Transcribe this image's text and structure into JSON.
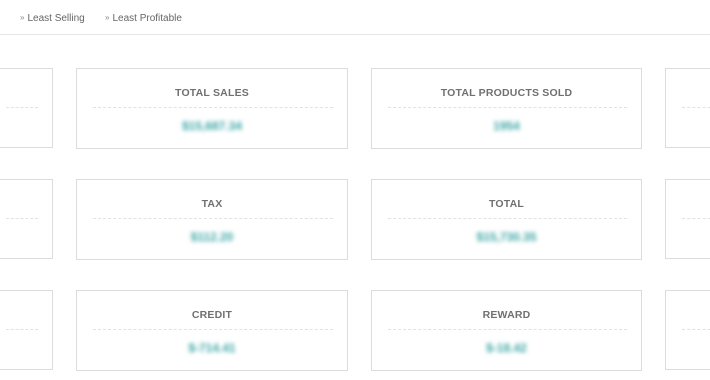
{
  "tabs": [
    {
      "label": "Least Selling",
      "icon": "chevron-double-down-icon"
    },
    {
      "label": "Least Profitable",
      "icon": "chevron-double-down-icon"
    }
  ],
  "cards": [
    {
      "title": "TOTAL SALES",
      "value": "$15,687.34"
    },
    {
      "title": "TOTAL PRODUCTS SOLD",
      "value": "1954"
    },
    {
      "title": "TAX",
      "value": "$112.20"
    },
    {
      "title": "TOTAL",
      "value": "$15,730.35"
    },
    {
      "title": "CREDIT",
      "value": "$-714.41"
    },
    {
      "title": "REWARD",
      "value": "$-18.42"
    }
  ],
  "colors": {
    "accent": "#3aa3a3",
    "title": "#707070",
    "border": "#dcdcdc"
  }
}
